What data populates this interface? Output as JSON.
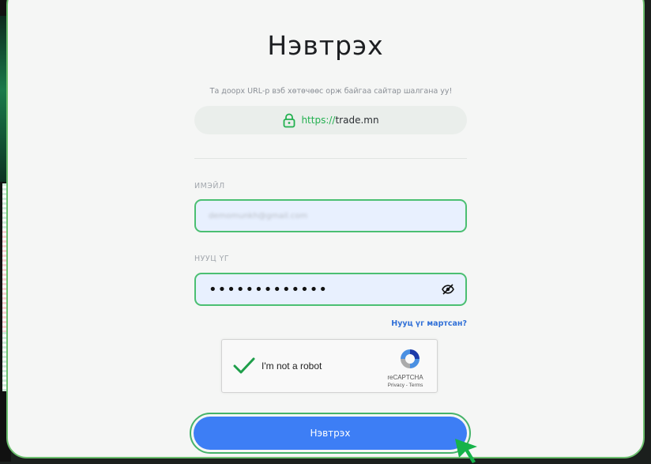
{
  "title": "Нэвтрэх",
  "url_note": "Та доорх URL-р вэб хөтөчөөс орж байгаа сайтар шалгана уу!",
  "url": {
    "protocol": "https://",
    "domain": "trade.mn",
    "icon": "lock-icon"
  },
  "email": {
    "label": "ИМЭЙЛ",
    "value": "demomunkh@gmail.com"
  },
  "password": {
    "label": "НУУЦ ҮГ",
    "value": "•••••••••••••",
    "toggle_icon": "eye-icon"
  },
  "forgot_link": "Нууц үг мартсан?",
  "captcha": {
    "label": "I'm not a robot",
    "brand": "reCAPTCHA",
    "links": "Privacy - Terms",
    "checked": true
  },
  "login_button": "Нэвтрэх",
  "colors": {
    "accent_green": "#4bbf72",
    "button_blue": "#3d7ef5",
    "link_blue": "#2f6fd7"
  }
}
